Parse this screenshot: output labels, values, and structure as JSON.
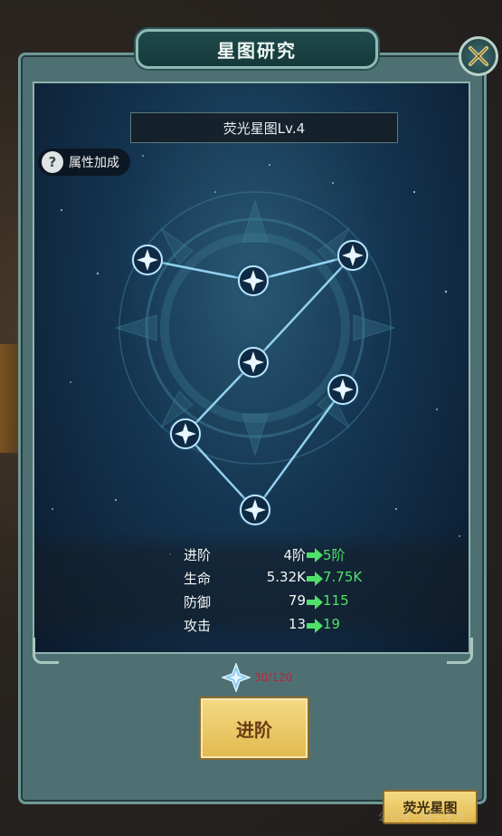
{
  "window": {
    "title": "星图研究"
  },
  "header": {
    "level_title": "荧光星图Lv.4",
    "attr_button_label": "属性加成",
    "help_icon": "?"
  },
  "stats": [
    {
      "label": "进阶",
      "from": "4阶",
      "to": "5阶"
    },
    {
      "label": "生命",
      "from": "5.32K",
      "to": "7.75K"
    },
    {
      "label": "防御",
      "from": "79",
      "to": "115"
    },
    {
      "label": "攻击",
      "from": "13",
      "to": "19"
    }
  ],
  "cost": {
    "text": "30/120",
    "icon": "star-shard-icon"
  },
  "buttons": {
    "advance_label": "进阶",
    "tab_label": "荧光星图",
    "close_icon": "close-icon"
  },
  "watermark": "公众号 · 闲先手游",
  "colors": {
    "panel": "#4f7072",
    "accent_green": "#4fe06a",
    "cost_red": "#c0203a",
    "gold": "#e2b94e"
  }
}
